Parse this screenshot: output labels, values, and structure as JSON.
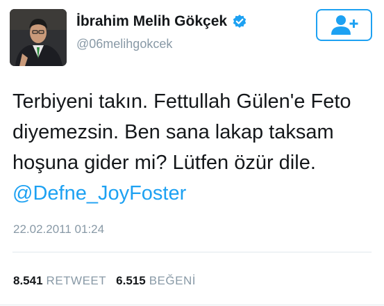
{
  "profile": {
    "display_name": "İbrahim Melih Gökçek",
    "handle": "@06melihgokcek",
    "verified": true
  },
  "follow_button": {
    "icon": "add-user-icon"
  },
  "tweet": {
    "text": "Terbiyeni takın. Fettullah Gülen'e Feto diyemezsin. Ben sana lakap taksam hoşuna gider mi? Lütfen özür dile.",
    "mention": "@Defne_JoyFoster",
    "timestamp": "22.02.2011 01:24"
  },
  "stats": {
    "retweets_count": "8.541",
    "retweets_label": "RETWEET",
    "likes_count": "6.515",
    "likes_label": "BEĞENİ"
  },
  "colors": {
    "accent": "#1da1f2",
    "text": "#14171a",
    "muted": "#8899a6"
  }
}
